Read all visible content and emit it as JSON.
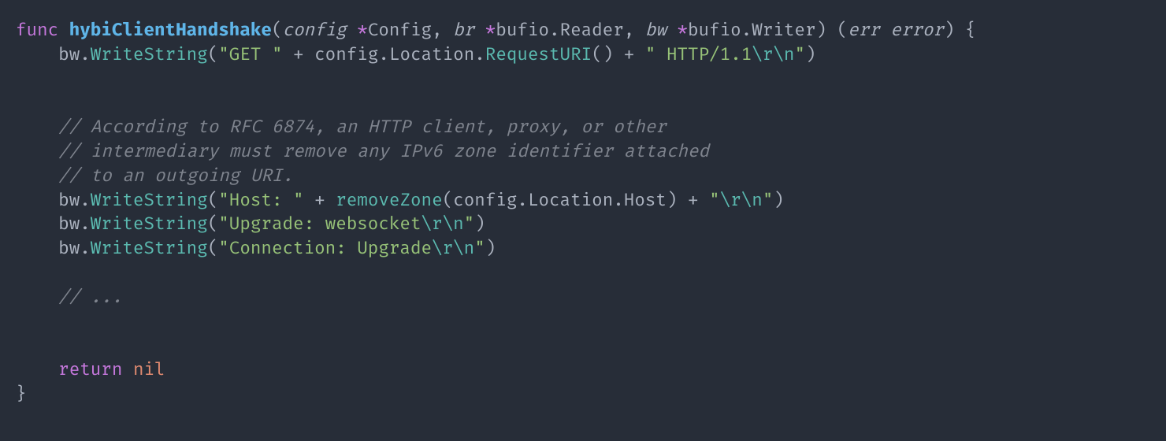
{
  "code": {
    "kw_func": "func",
    "fn_name": "hybiClientHandshake",
    "param_config": "config",
    "type_Config": "Config",
    "param_br": "br",
    "type_Reader": "bufio.Reader",
    "param_bw": "bw",
    "type_Writer": "bufio.Writer",
    "ret_err": "err",
    "ret_error": "error",
    "id_bw": "bw",
    "call_WriteString": "WriteString",
    "str_get": "\"GET \"",
    "id_config": "config",
    "prop_Location": "Location",
    "call_RequestURI": "RequestURI",
    "str_http11_open": "\" HTTP/1.1",
    "esc_r": "\\r",
    "esc_n": "\\n",
    "str_close_q": "\"",
    "cmt1": "// According to RFC 6874, an HTTP client, proxy, or other",
    "cmt2": "// intermediary must remove any IPv6 zone identifier attached",
    "cmt3": "// to an outgoing URI.",
    "str_host": "\"Host: \"",
    "call_removeZone": "removeZone",
    "prop_Host": "Host",
    "str_rn_open": "\"",
    "str_upgrade_ws": "\"Upgrade: websocket",
    "str_conn_upgrade": "\"Connection: Upgrade",
    "cmt_ellipsis": "// ...",
    "kw_return": "return",
    "nil": "nil"
  }
}
